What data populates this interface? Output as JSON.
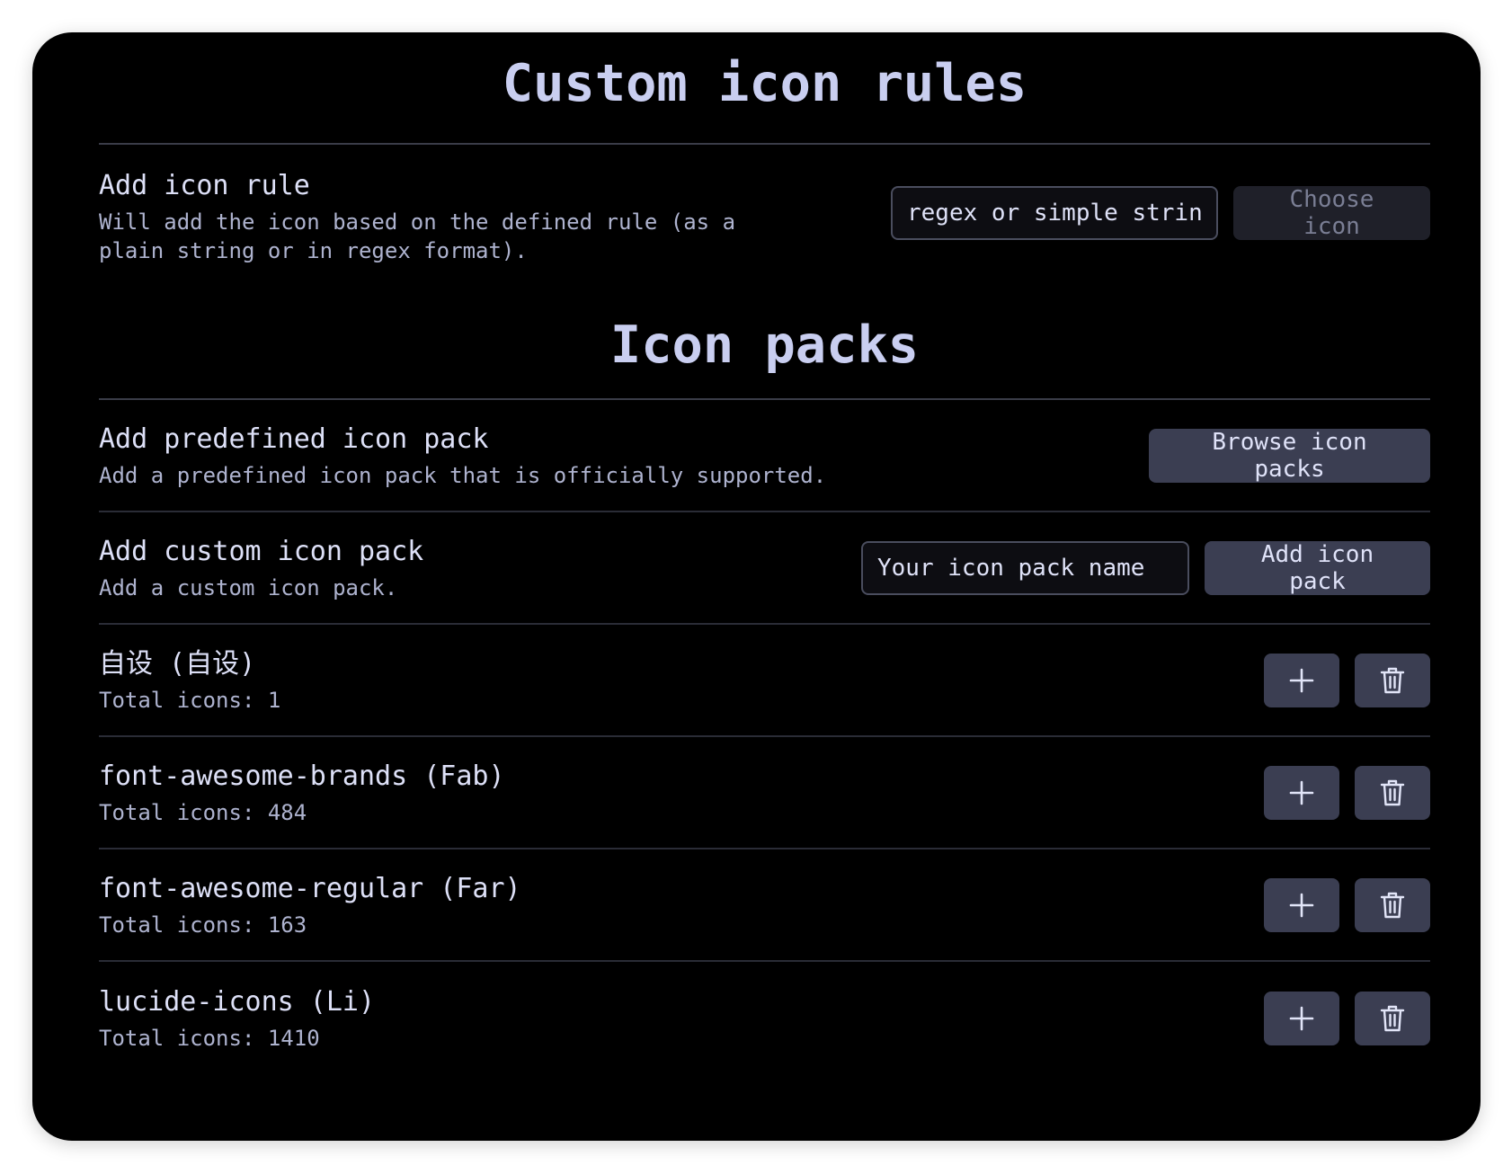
{
  "custom_rules": {
    "title": "Custom icon rules",
    "add_rule": {
      "name": "Add icon rule",
      "description": "Will add the icon based on the defined rule (as a plain string or in regex format).",
      "input_placeholder": "regex or simple strin",
      "choose_icon_label": "Choose icon"
    }
  },
  "icon_packs": {
    "title": "Icon packs",
    "predefined": {
      "name": "Add predefined icon pack",
      "description": "Add a predefined icon pack that is officially supported.",
      "button_label": "Browse icon packs"
    },
    "custom": {
      "name": "Add custom icon pack",
      "description": "Add a custom icon pack.",
      "input_placeholder": "Your icon pack name",
      "button_label": "Add icon pack"
    },
    "packs": [
      {
        "name": "自设 (自设)",
        "count": "Total icons: 1"
      },
      {
        "name": "font-awesome-brands (Fab)",
        "count": "Total icons: 484"
      },
      {
        "name": "font-awesome-regular (Far)",
        "count": "Total icons: 163"
      },
      {
        "name": "lucide-icons (Li)",
        "count": "Total icons: 1410"
      }
    ]
  },
  "icons": {
    "add": "plus-icon",
    "delete": "trash-icon"
  }
}
